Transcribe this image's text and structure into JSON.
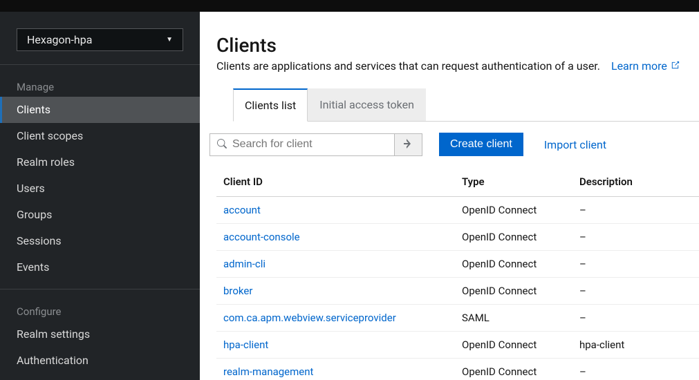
{
  "realm": "Hexagon-hpa",
  "sidebar": {
    "manage": {
      "header": "Manage",
      "items": [
        {
          "label": "Clients",
          "active": true
        },
        {
          "label": "Client scopes",
          "active": false
        },
        {
          "label": "Realm roles",
          "active": false
        },
        {
          "label": "Users",
          "active": false
        },
        {
          "label": "Groups",
          "active": false
        },
        {
          "label": "Sessions",
          "active": false
        },
        {
          "label": "Events",
          "active": false
        }
      ]
    },
    "configure": {
      "header": "Configure",
      "items": [
        {
          "label": "Realm settings",
          "active": false
        },
        {
          "label": "Authentication",
          "active": false
        }
      ]
    }
  },
  "page": {
    "title": "Clients",
    "description": "Clients are applications and services that can request authentication of a user.",
    "learn_more": "Learn more"
  },
  "tabs": [
    {
      "label": "Clients list",
      "active": true
    },
    {
      "label": "Initial access token",
      "active": false
    }
  ],
  "toolbar": {
    "search_placeholder": "Search for client",
    "create_label": "Create client",
    "import_label": "Import client"
  },
  "table": {
    "headers": {
      "client_id": "Client ID",
      "type": "Type",
      "description": "Description"
    },
    "rows": [
      {
        "client_id": "account",
        "type": "OpenID Connect",
        "description": "–"
      },
      {
        "client_id": "account-console",
        "type": "OpenID Connect",
        "description": "–"
      },
      {
        "client_id": "admin-cli",
        "type": "OpenID Connect",
        "description": "–"
      },
      {
        "client_id": "broker",
        "type": "OpenID Connect",
        "description": "–"
      },
      {
        "client_id": "com.ca.apm.webview.serviceprovider",
        "type": "SAML",
        "description": "–"
      },
      {
        "client_id": "hpa-client",
        "type": "OpenID Connect",
        "description": "hpa-client"
      },
      {
        "client_id": "realm-management",
        "type": "OpenID Connect",
        "description": "–"
      }
    ]
  }
}
